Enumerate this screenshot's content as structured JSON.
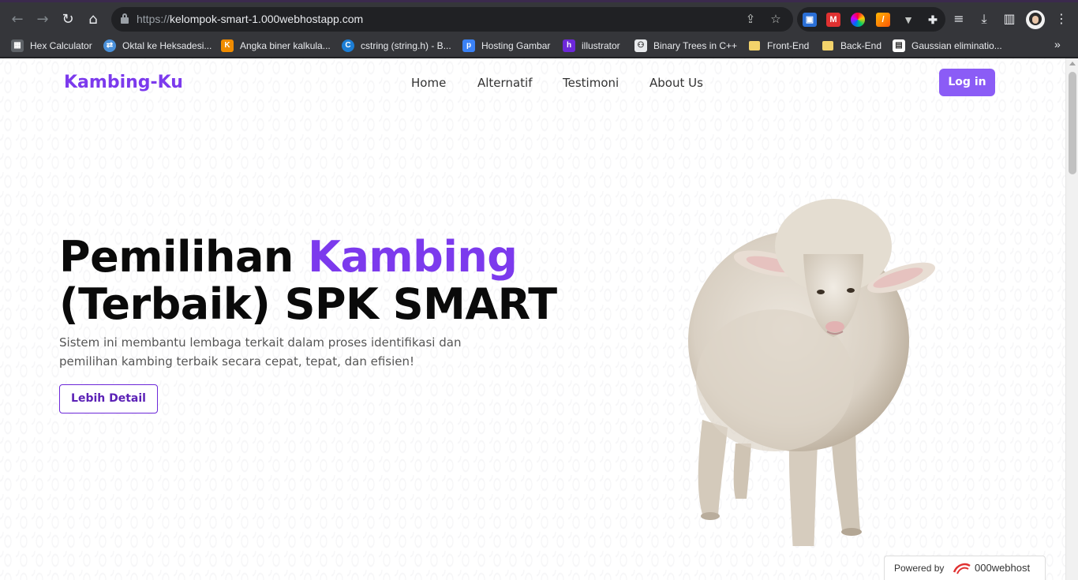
{
  "browser": {
    "url_protocol": "https://",
    "url_host": "kelompok-smart-1.000webhostapp.com",
    "bookmarks": [
      {
        "label": "Hex Calculator",
        "icon": "calculator-icon"
      },
      {
        "label": "Oktal ke Heksadesi...",
        "icon": "converter-icon"
      },
      {
        "label": "Angka biner kalkula...",
        "icon": "binary-icon"
      },
      {
        "label": "cstring (string.h) - B...",
        "icon": "cplusplus-icon"
      },
      {
        "label": "Hosting Gambar",
        "icon": "postimage-icon"
      },
      {
        "label": "illustrator",
        "icon": "h-icon"
      },
      {
        "label": "Binary Trees in C++",
        "icon": "tree-icon"
      },
      {
        "label": "Front-End",
        "icon": "folder-icon"
      },
      {
        "label": "Back-End",
        "icon": "folder-icon"
      },
      {
        "label": "Gaussian eliminatio...",
        "icon": "matrix-icon"
      }
    ],
    "more_glyph": "»"
  },
  "site": {
    "brand": "Kambing-Ku",
    "nav": [
      "Home",
      "Alternatif",
      "Testimoni",
      "About Us"
    ],
    "login_label": "Log in",
    "accent_color": "#7c3aed"
  },
  "hero": {
    "title_part1": "Pemilihan ",
    "title_accent": "Kambing",
    "title_line2": "(Terbaik) SPK SMART",
    "description": "Sistem ini membantu lembaga terkait dalam proses identifikasi dan pemilihan kambing terbaik secara cepat, tepat, dan efisien!",
    "button_label": "Lebih Detail"
  },
  "footer_badge": {
    "label": "Powered by",
    "name": "000webhost"
  }
}
